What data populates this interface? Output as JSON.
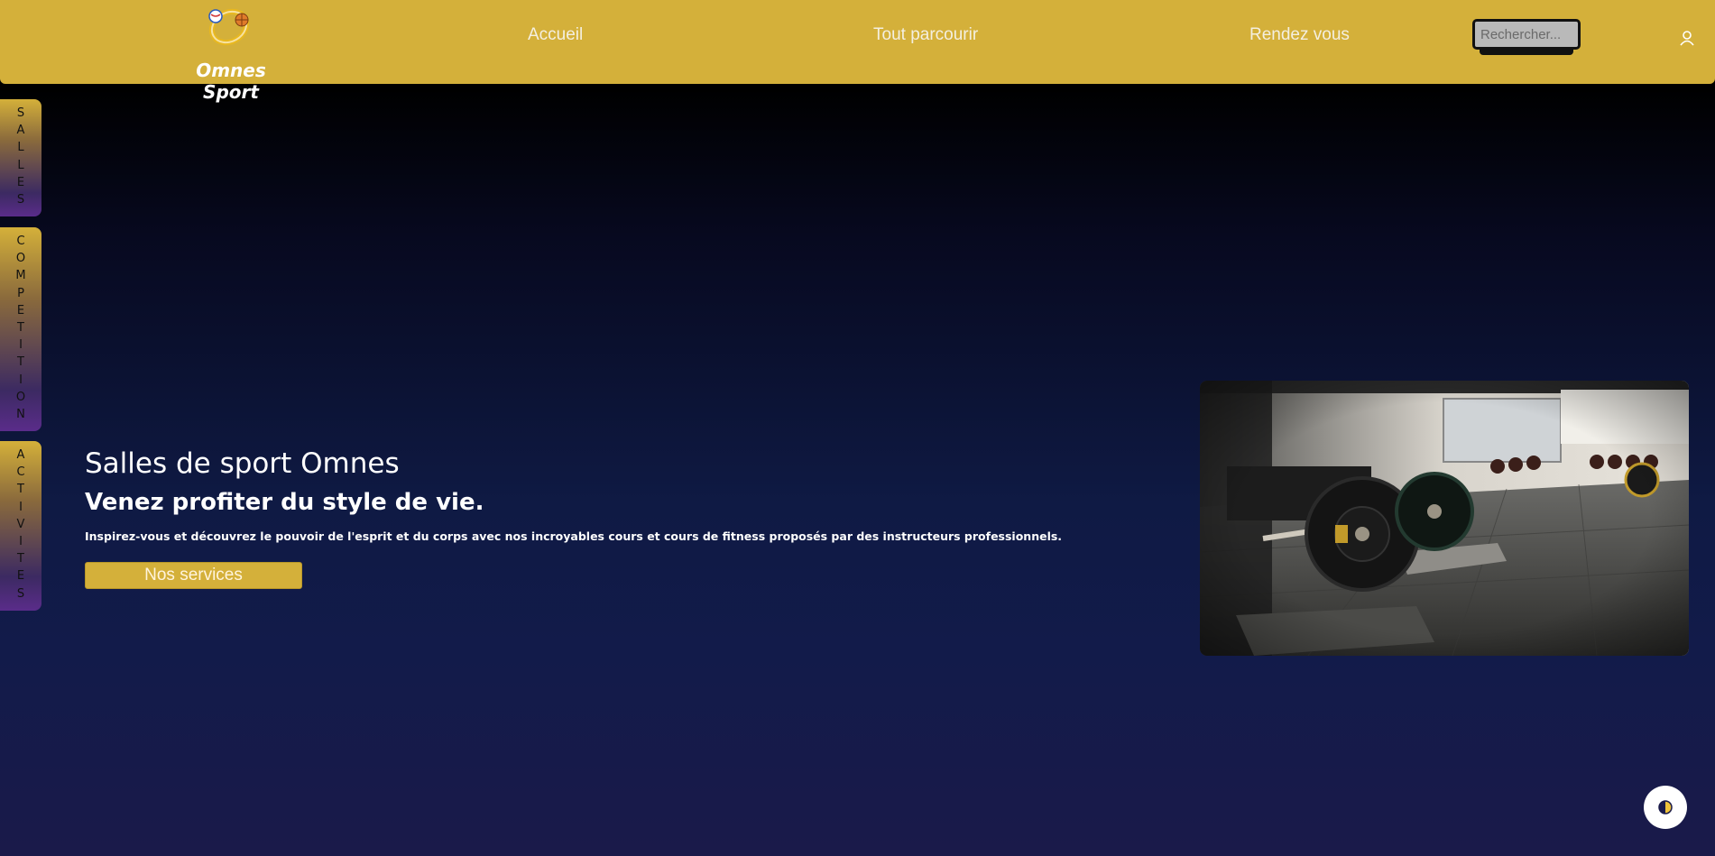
{
  "brand": {
    "name": "Omnes Sport",
    "logo_icon": "sports-ring-logo-icon"
  },
  "nav": {
    "links": [
      "Accueil",
      "Tout parcourir",
      "Rendez vous"
    ]
  },
  "search": {
    "placeholder": "Rechercher...",
    "value": ""
  },
  "user": {
    "icon": "user-icon"
  },
  "side_tabs": [
    "SALLES",
    "COMPETITION",
    "ACTIVITES"
  ],
  "hero": {
    "title": "Salles de sport Omnes",
    "subtitle": "Venez profiter du style de vie.",
    "description": "Inspirez-vous et découvrez le pouvoir de l'esprit et du corps avec nos incroyables cours et cours de fitness proposés par des instructeurs professionnels.",
    "button_label": "Nos services"
  },
  "image": {
    "subject": "gym-barbell-photo"
  },
  "theme_toggle": {
    "icon": "contrast-icon"
  },
  "colors": {
    "header": "#d4b03a",
    "accent": "#d4b03a",
    "background_top": "#000000",
    "background_bottom": "#1a1a4a"
  }
}
